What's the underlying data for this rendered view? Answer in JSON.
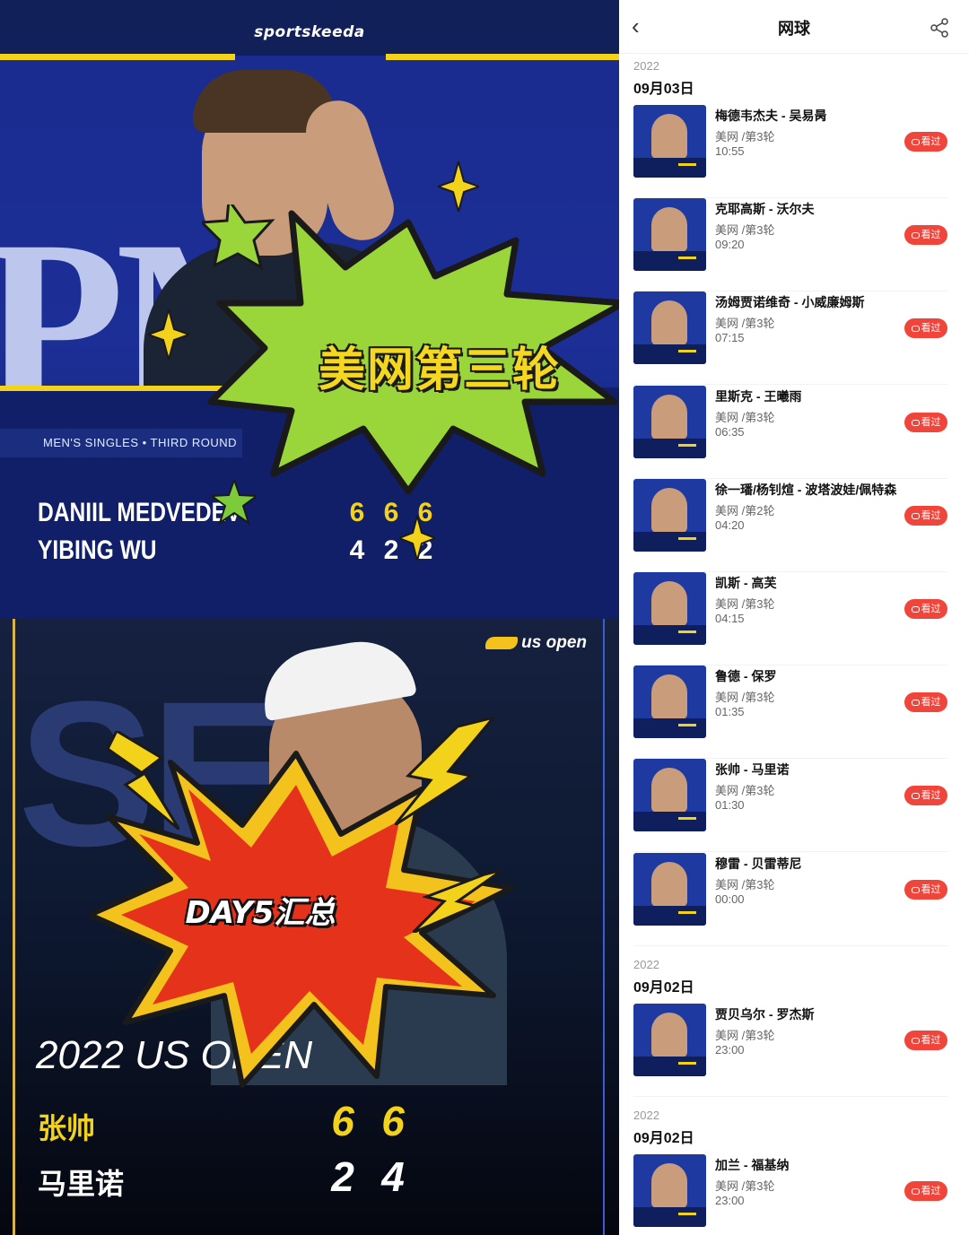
{
  "poster_top": {
    "brand": "sportskeeda",
    "round_label": "MEN'S SINGLES • THIRD ROUND",
    "burst_text": "美网第三轮",
    "players": [
      {
        "name": "DANIIL MEDVEDEV",
        "scores": [
          "6",
          "6",
          "6"
        ]
      },
      {
        "name": "YIBING WU",
        "scores": [
          "4",
          "2",
          "2"
        ]
      }
    ],
    "colors": {
      "accent": "#f3d21c",
      "background": "#1c2f97",
      "burst": "#9ad63a"
    }
  },
  "poster_bottom": {
    "logo": "us open",
    "burst_text": "DAY5汇总",
    "title": "2022 US OPEN",
    "players": [
      {
        "name": "张帅",
        "scores": [
          "6",
          "6"
        ],
        "color": "#f3d21c"
      },
      {
        "name": "马里诺",
        "scores": [
          "2",
          "4"
        ],
        "color": "#ffffff"
      }
    ],
    "colors": {
      "burst": "#e4321b",
      "burst_edge": "#f3c21c"
    }
  },
  "app": {
    "nav": {
      "back_icon": "‹",
      "title": "网球",
      "share_icon": "share-icon"
    },
    "groups": [
      {
        "year": "2022",
        "date": "09月03日",
        "matches": [
          {
            "name": "梅德韦杰夫 - 吴易昺",
            "league": "美网 /第3轮",
            "time": "10:55",
            "button": "看过"
          },
          {
            "name": "克耶高斯 - 沃尔夫",
            "league": "美网 /第3轮",
            "time": "09:20",
            "button": "看过"
          },
          {
            "name": "汤姆贾诺维奇 - 小威廉姆斯",
            "league": "美网 /第3轮",
            "time": "07:15",
            "button": "看过"
          },
          {
            "name": "里斯克 - 王曦雨",
            "league": "美网 /第3轮",
            "time": "06:35",
            "button": "看过"
          },
          {
            "name": "徐一璠/杨钊煊 - 波塔波娃/佩特森",
            "league": "美网 /第2轮",
            "time": "04:20",
            "button": "看过"
          },
          {
            "name": "凯斯 - 高芙",
            "league": "美网 /第3轮",
            "time": "04:15",
            "button": "看过"
          },
          {
            "name": "鲁德 - 保罗",
            "league": "美网 /第3轮",
            "time": "01:35",
            "button": "看过"
          },
          {
            "name": "张帅 - 马里诺",
            "league": "美网 /第3轮",
            "time": "01:30",
            "button": "看过"
          },
          {
            "name": "穆雷 - 贝雷蒂尼",
            "league": "美网 /第3轮",
            "time": "00:00",
            "button": "看过"
          }
        ]
      },
      {
        "year": "2022",
        "date": "09月02日",
        "matches": [
          {
            "name": "贾贝乌尔 - 罗杰斯",
            "league": "美网 /第3轮",
            "time": "23:00",
            "button": "看过"
          }
        ]
      },
      {
        "year": "2022",
        "date": "09月02日",
        "matches": [
          {
            "name": "加兰 - 福基纳",
            "league": "美网 /第3轮",
            "time": "23:00",
            "button": "看过"
          }
        ]
      }
    ]
  }
}
